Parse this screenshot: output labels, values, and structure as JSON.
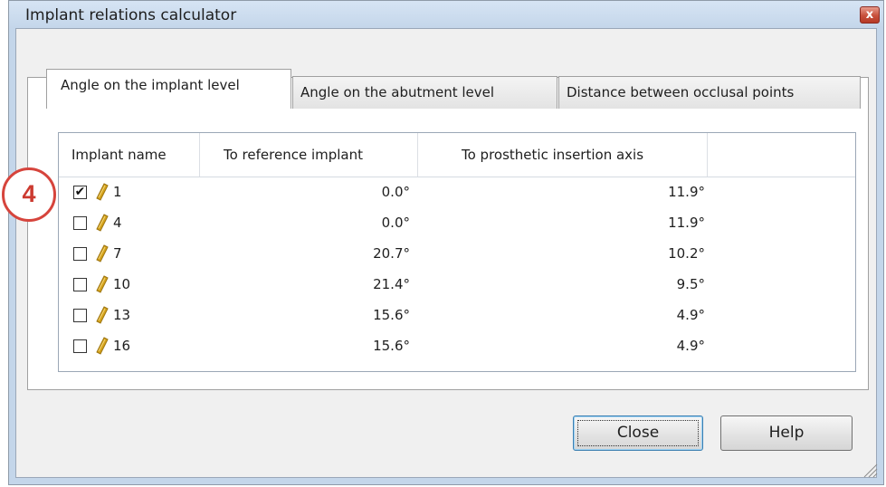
{
  "window": {
    "title": "Implant relations calculator",
    "close_glyph": "x"
  },
  "tabs": [
    {
      "label": "Angle on the implant level",
      "active": true
    },
    {
      "label": "Angle on the abutment level",
      "active": false
    },
    {
      "label": "Distance between occlusal points",
      "active": false
    }
  ],
  "table": {
    "columns": [
      "Implant name",
      "To reference implant",
      "To prosthetic insertion axis"
    ],
    "rows": [
      {
        "checked": true,
        "name": "1",
        "ref": "0.0°",
        "axis": "11.9°"
      },
      {
        "checked": false,
        "name": "4",
        "ref": "0.0°",
        "axis": "11.9°"
      },
      {
        "checked": false,
        "name": "7",
        "ref": "20.7°",
        "axis": "10.2°"
      },
      {
        "checked": false,
        "name": "10",
        "ref": "21.4°",
        "axis": "9.5°"
      },
      {
        "checked": false,
        "name": "13",
        "ref": "15.6°",
        "axis": "4.9°"
      },
      {
        "checked": false,
        "name": "16",
        "ref": "15.6°",
        "axis": "4.9°"
      }
    ],
    "row_icon": "implant-icon",
    "check_glyph": "✔"
  },
  "buttons": {
    "close_label": "Close",
    "help_label": "Help"
  },
  "callout": {
    "label": "4"
  },
  "colors": {
    "implant_icon": "#d4a21a",
    "callout": "#d6443c",
    "title_close": "#c8503c"
  }
}
